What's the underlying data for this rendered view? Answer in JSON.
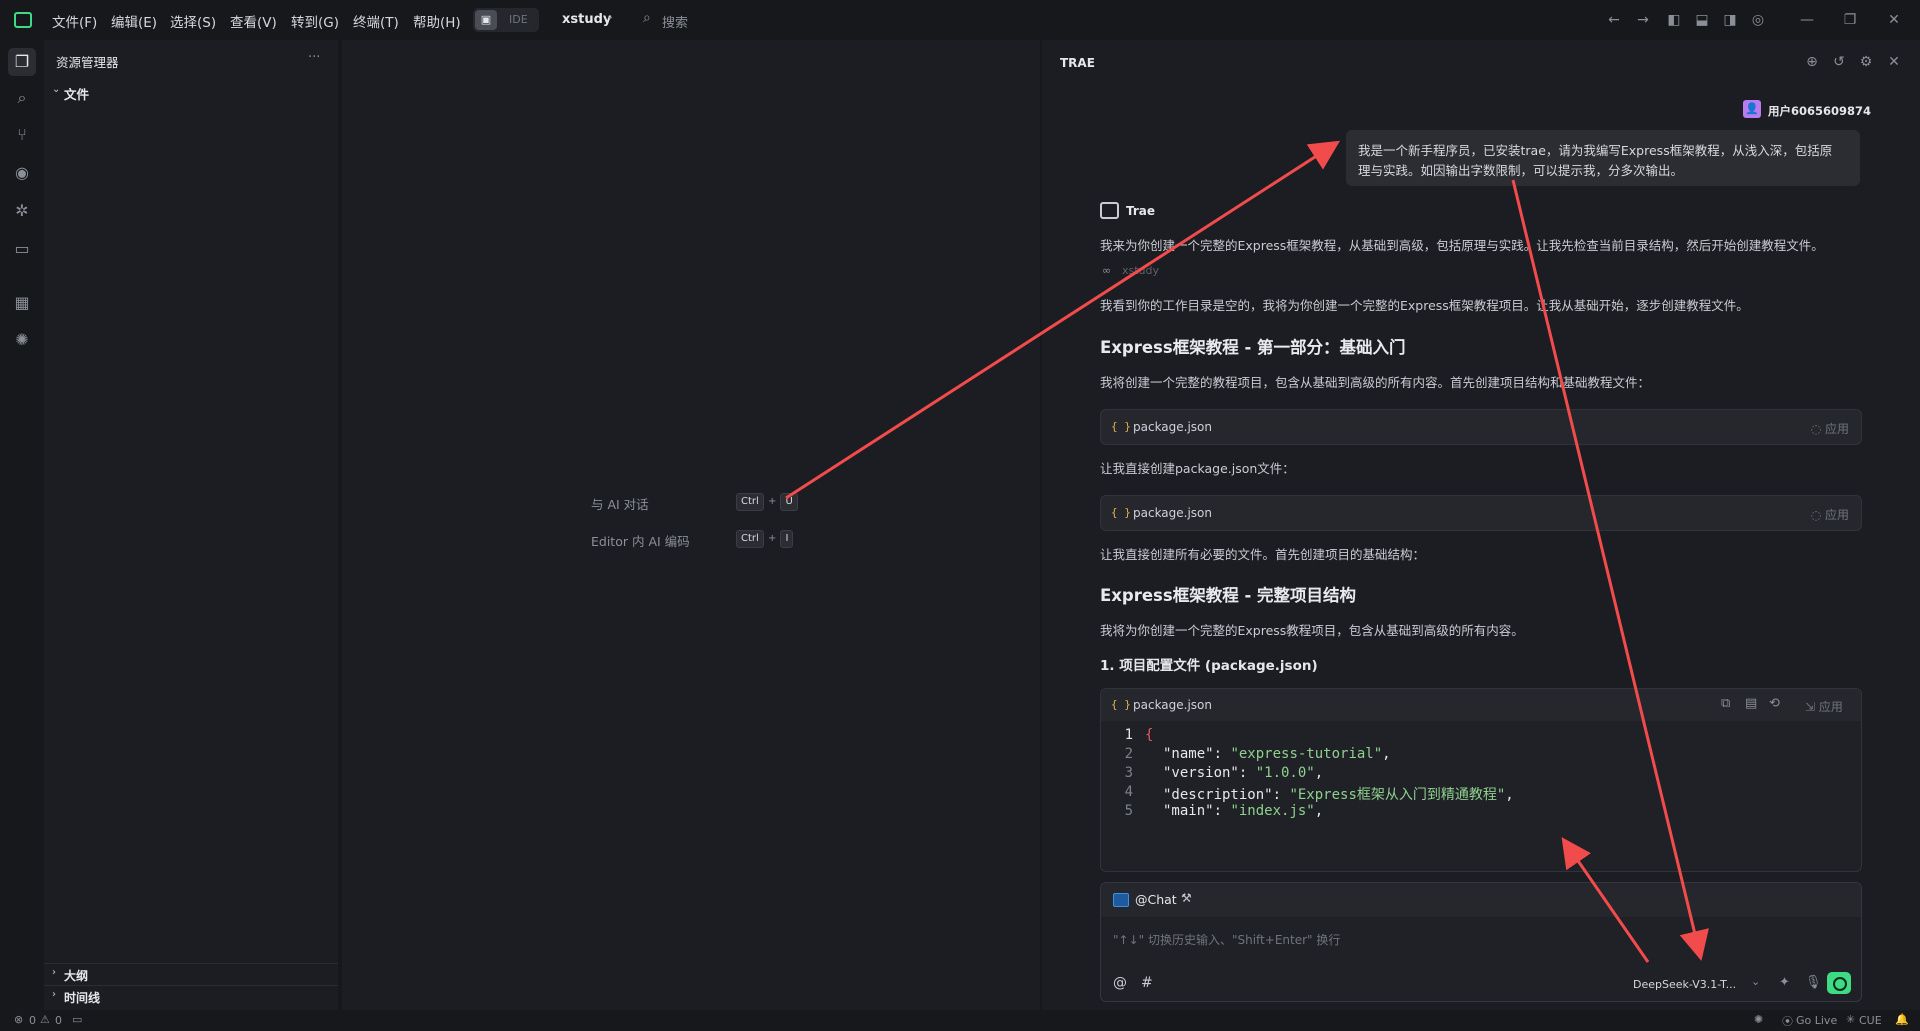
{
  "titlebar": {
    "menus": [
      "文件(F)",
      "编辑(E)",
      "选择(S)",
      "查看(V)",
      "转到(G)",
      "终端(T)",
      "帮助(H)"
    ],
    "mode_label": "IDE",
    "workspace": "xstudy",
    "search_label": "搜索"
  },
  "explorer": {
    "title": "资源管理器",
    "more": "···",
    "folder_label": "文件",
    "outline_label": "大纲",
    "timeline_label": "时间线"
  },
  "editor": {
    "hint1_label": "与 AI 对话",
    "hint1_keys": [
      "Ctrl",
      "+",
      "U"
    ],
    "hint2_label": "Editor 内 AI 编码",
    "hint2_keys": [
      "Ctrl",
      "+",
      "I"
    ]
  },
  "chat": {
    "title": "TRAE",
    "user_name": "用户6065609874",
    "user_message_line1": "我是一个新手程序员，已安装trae，请为我编写Express框架教程，从浅入深，包括原",
    "user_message_line2": "理与实践。如因输出字数限制，可以提示我，分多次输出。",
    "assistant_name": "Trae",
    "p1": "我来为你创建一个完整的Express框架教程，从基础到高级，包括原理与实践。让我先检查当前目录结构，然后开始创建教程文件。",
    "tool_label": "xstudy",
    "p2": "我看到你的工作目录是空的，我将为你创建一个完整的Express框架教程项目。让我从基础开始，逐步创建教程文件。",
    "h_part1": "Express框架教程 - 第一部分：基础入门",
    "p3": "我将创建一个完整的教程项目，包含从基础到高级的所有内容。首先创建项目结构和基础教程文件：",
    "card1_file": "package.json",
    "card_apply": "应用",
    "p4": "让我直接创建package.json文件：",
    "card2_file": "package.json",
    "p5": "让我直接创建所有必要的文件。首先创建项目的基础结构：",
    "h_full": "Express框架教程 - 完整项目结构",
    "p6": "我将为你创建一个完整的Express教程项目，包含从基础到高级的所有内容。",
    "h_section1": "1. 项目配置文件 (package.json)",
    "card3_file": "package.json",
    "code_lines": [
      {
        "n": "1",
        "k": "",
        "v": "{"
      },
      {
        "n": "2",
        "k": "\"name\"",
        "v": "\"express-tutorial\","
      },
      {
        "n": "3",
        "k": "\"version\"",
        "v": "\"1.0.0\","
      },
      {
        "n": "4",
        "k": "\"description\"",
        "v": "\"Express框架从入门到精通教程\","
      },
      {
        "n": "5",
        "k": "\"main\"",
        "v": "\"index.js\","
      }
    ],
    "input_tag": "@Chat",
    "input_placeholder": "\"↑↓\" 切换历史输入、\"Shift+Enter\" 换行",
    "at_symbol": "@",
    "hash_symbol": "#",
    "model": "DeepSeek-V3.1-T..."
  },
  "statusbar": {
    "errors": "0",
    "warnings": "0",
    "go_live": "Go Live",
    "cue": "CUE"
  },
  "colors": {
    "accent_green": "#3ddc84",
    "arrow_red": "#f24b4b",
    "user_purple": "#b97cf0"
  }
}
